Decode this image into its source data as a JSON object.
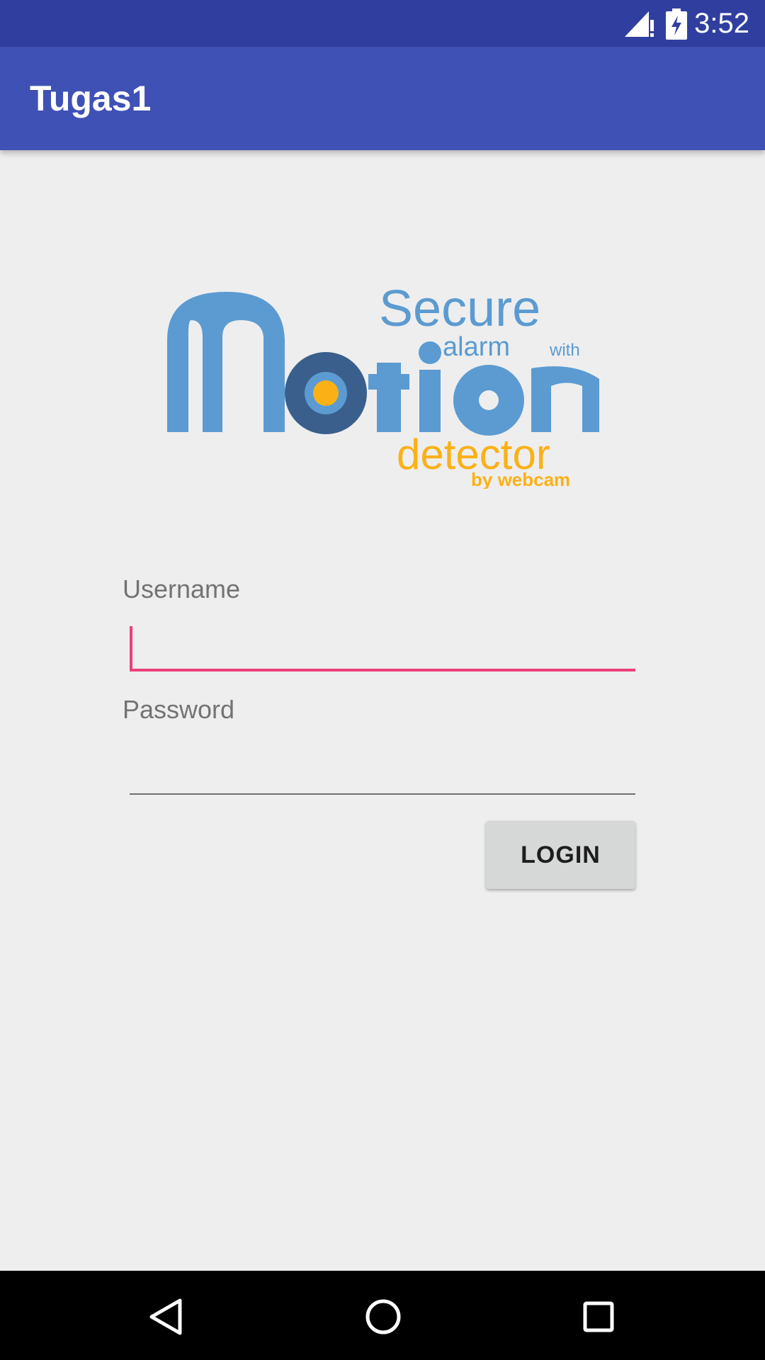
{
  "status_bar": {
    "time": "3:52",
    "icons": [
      "signal-no-data-icon",
      "battery-charging-icon"
    ]
  },
  "app_bar": {
    "title": "Tugas1",
    "color": "#3f51b5",
    "status_color": "#303f9f"
  },
  "logo": {
    "line1": "Secure",
    "line2": "alarm",
    "line2_suffix": "with",
    "line3": "Motion",
    "line4": "detector",
    "line5": "by webcam",
    "blue": "#5b9bd1",
    "dark_blue": "#3a5f8c",
    "orange": "#fbb116"
  },
  "form": {
    "username_label": "Username",
    "username_value": "",
    "password_label": "Password",
    "password_value": "",
    "accent": "#ec407a"
  },
  "login_button": {
    "label": "LOGIN"
  },
  "nav_bar": {
    "icons": [
      "back-icon",
      "home-icon",
      "recents-icon"
    ]
  }
}
